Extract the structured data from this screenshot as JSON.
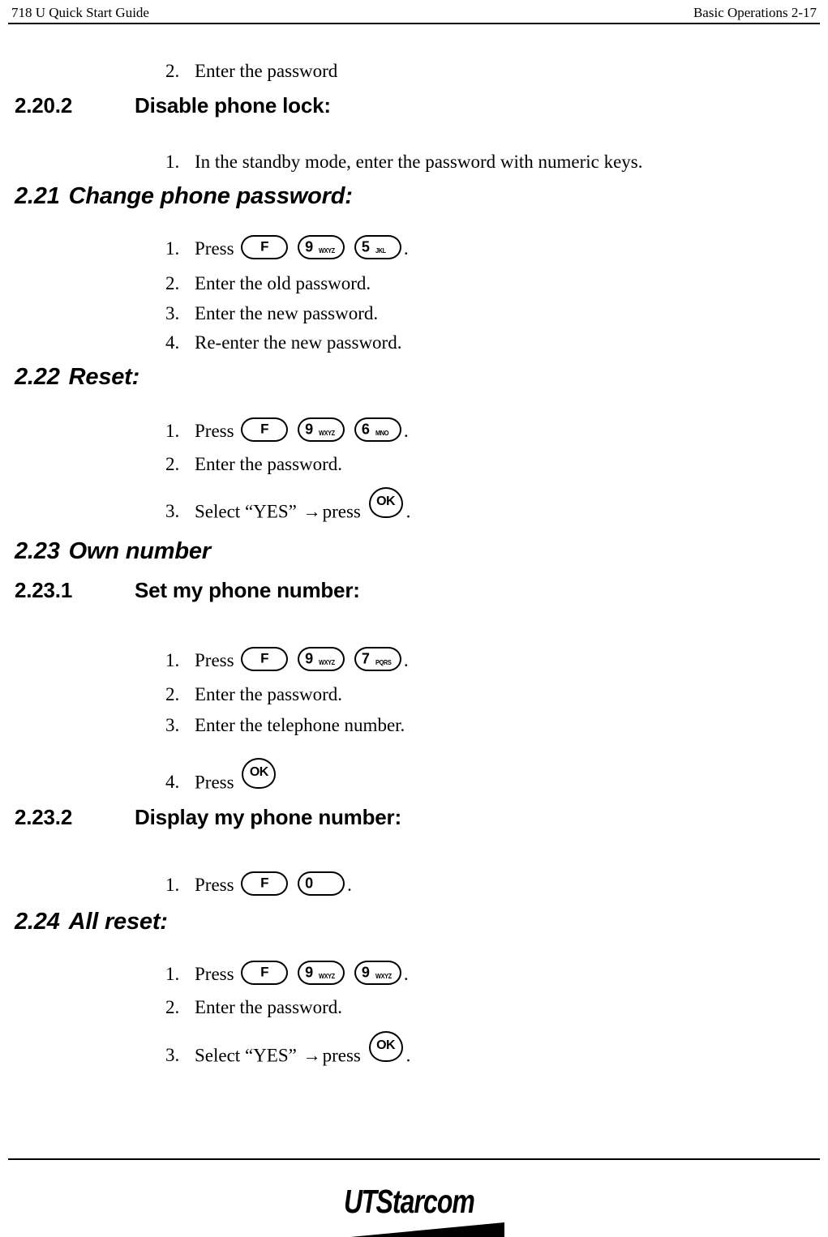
{
  "header": {
    "left": "718 U Quick Start Guide",
    "right": "Basic Operations 2-17"
  },
  "footer": {
    "logo_ut": "UT",
    "logo_starcom": "Starcom"
  },
  "keys": {
    "f": {
      "main": "F",
      "sub": ""
    },
    "zero": {
      "main": "0",
      "sub": ""
    },
    "five": {
      "main": "5",
      "sub": "JKL"
    },
    "six": {
      "main": "6",
      "sub": "MNO"
    },
    "seven": {
      "main": "7",
      "sub": "PQRS"
    },
    "nine": {
      "main": "9",
      "sub": "WXYZ"
    },
    "ok": {
      "main": "OK",
      "sub": ""
    }
  },
  "content": {
    "orphan_step": {
      "num": "2.",
      "text": "Enter the password"
    },
    "sec_2_20_2": {
      "number": "2.20.2",
      "title": "Disable phone lock:",
      "step1": {
        "num": "1.",
        "text": "In the standby mode, enter the password with numeric keys."
      }
    },
    "sec_2_21": {
      "number": "2.21",
      "title": "Change phone password:",
      "step1_pre": "Press",
      "step1_post": ".",
      "step1_num": "1.",
      "step2": {
        "num": "2.",
        "text": "Enter the old password."
      },
      "step3": {
        "num": "3.",
        "text": "Enter the new password."
      },
      "step4": {
        "num": "4.",
        "text": "Re-enter the new password."
      }
    },
    "sec_2_22": {
      "number": "2.22",
      "title": "Reset:",
      "step1_num": "1.",
      "step1_pre": "Press",
      "step1_post": ".",
      "step2": {
        "num": "2.",
        "text": "Enter the password."
      },
      "step3_num": "3.",
      "step3_pre": "Select “YES”",
      "step3_arrow": "→",
      "step3_mid": "press",
      "step3_post": "."
    },
    "sec_2_23": {
      "number": "2.23",
      "title": "Own number"
    },
    "sec_2_23_1": {
      "number": "2.23.1",
      "title": "Set my phone number:",
      "step1_num": "1.",
      "step1_pre": "Press",
      "step1_post": ".",
      "step2": {
        "num": "2.",
        "text": "Enter the password."
      },
      "step3": {
        "num": "3.",
        "text": "Enter the telephone number."
      },
      "step4_num": "4.",
      "step4_pre": "Press"
    },
    "sec_2_23_2": {
      "number": "2.23.2",
      "title": "Display my phone number:",
      "step1_num": "1.",
      "step1_pre": "Press",
      "step1_post": "."
    },
    "sec_2_24": {
      "number": "2.24",
      "title": "All reset:",
      "step1_num": "1.",
      "step1_pre": "Press",
      "step1_post": ".",
      "step2": {
        "num": "2.",
        "text": "Enter the password."
      },
      "step3_num": "3.",
      "step3_pre": "Select “YES”",
      "step3_arrow": "→",
      "step3_mid": "press",
      "step3_post": "."
    }
  }
}
